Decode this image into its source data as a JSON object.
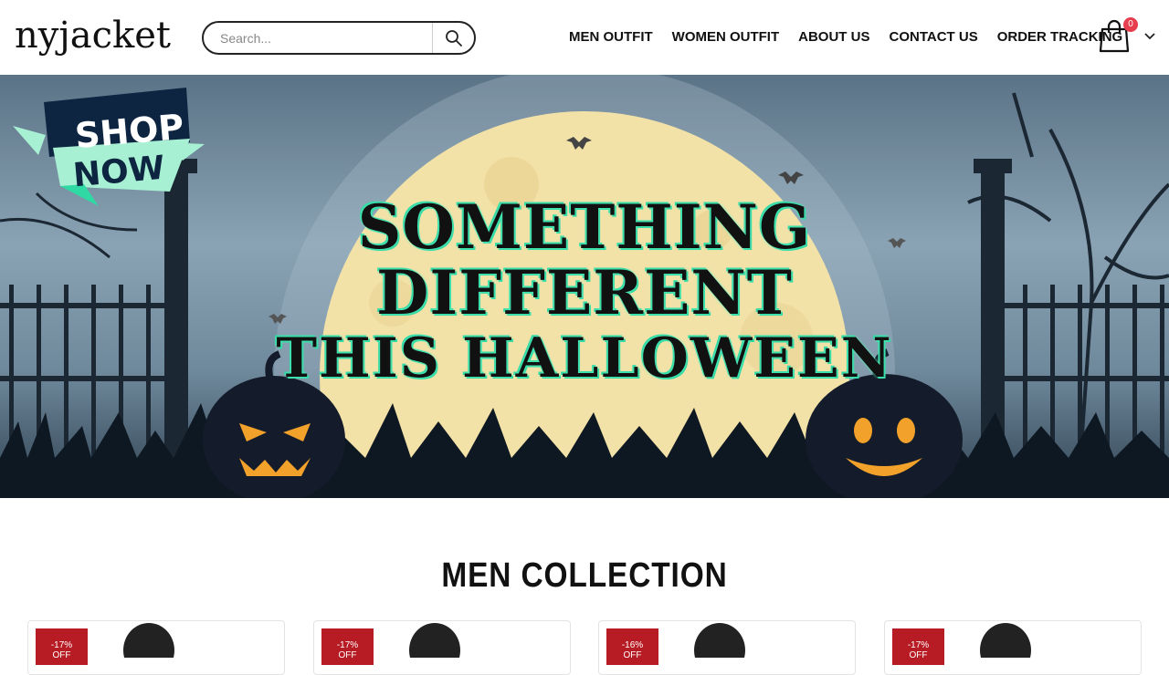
{
  "header": {
    "logo_text": "nyjacket",
    "search": {
      "placeholder": "Search...",
      "value": ""
    },
    "nav": [
      {
        "label": "MEN OUTFIT"
      },
      {
        "label": "WOMEN OUTFIT"
      },
      {
        "label": "ABOUT US"
      },
      {
        "label": "CONTACT US"
      },
      {
        "label": "ORDER TRACKING"
      }
    ],
    "cart": {
      "count": "0",
      "icon": "shopping-bag-icon"
    },
    "dropdown_icon": "chevron-down-icon"
  },
  "hero": {
    "shop_now": {
      "line1": "SHOP",
      "line2": "NOW"
    },
    "headline": [
      "SOMETHING",
      "DIFFERENT",
      "THIS HALLOWEEN"
    ],
    "colors": {
      "sky": "#6f899c",
      "moon": "#f3e2a8",
      "glow": "#2fd9a4",
      "pumpkin_face": "#f2a12b",
      "ribbon_dark": "#0d2540",
      "ribbon_light": "#a7f0d3"
    }
  },
  "collection": {
    "title": "MEN COLLECTION",
    "products": [
      {
        "discount": "-17%",
        "off": "OFF"
      },
      {
        "discount": "-17%",
        "off": "OFF"
      },
      {
        "discount": "-16%",
        "off": "OFF"
      },
      {
        "discount": "-17%",
        "off": "OFF"
      }
    ],
    "badge_color": "#b71c24"
  }
}
